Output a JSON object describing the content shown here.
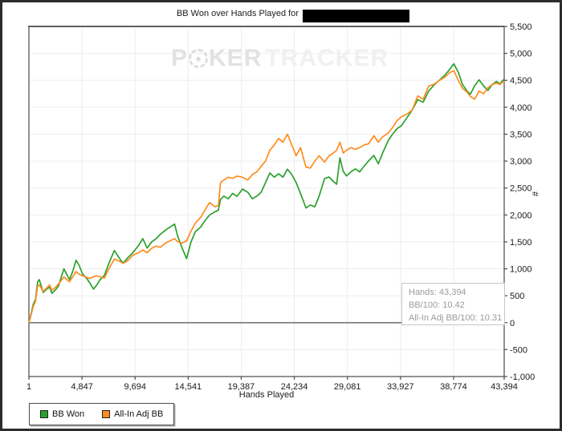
{
  "title": {
    "text": "BB Won over Hands Played for",
    "redacted_subject": ""
  },
  "watermark": {
    "p": "P",
    "ker": "KER",
    "tracker": "TRACKER",
    "spade": "♠"
  },
  "info_box": {
    "lines": [
      "Hands: 43,394",
      "BB/100: 10.42",
      "All-In Adj BB/100: 10.31"
    ]
  },
  "legend": {
    "items": [
      {
        "label": "BB Won",
        "color": "#2ca02c"
      },
      {
        "label": "All-In Adj BB",
        "color": "#ff8c1f"
      }
    ]
  },
  "chart_data": {
    "type": "line",
    "title": "BB Won over Hands Played for",
    "xlabel": "Hands Played",
    "ylabel": "#",
    "xlim": [
      1,
      43394
    ],
    "ylim": [
      -1000,
      5500
    ],
    "grid": true,
    "grid_color": "#ededed",
    "zero_line_color": "#787878",
    "axis_color": "#4a4a4a",
    "legend_position": "bottom-left",
    "x_ticks": {
      "values": [
        1,
        4847,
        9694,
        14541,
        19387,
        24234,
        29081,
        33927,
        38774,
        43394
      ],
      "labels": [
        "1",
        "4,847",
        "9,694",
        "14,541",
        "19,387",
        "24,234",
        "29,081",
        "33,927",
        "38,774",
        "43,394"
      ]
    },
    "y_ticks": {
      "values": [
        5500,
        5000,
        4500,
        4000,
        3500,
        3000,
        2500,
        2000,
        1500,
        1000,
        500,
        0,
        -500,
        -1000
      ],
      "labels": [
        "5,500",
        "5,000",
        "4,500",
        "4,000",
        "3,500",
        "3,000",
        "2,500",
        "2,000",
        "1,500",
        "1,000",
        "500",
        "0",
        "-500",
        "-1,000"
      ]
    },
    "series": [
      {
        "name": "BB Won",
        "color": "#2ca02c",
        "points": [
          [
            1,
            0
          ],
          [
            200,
            160
          ],
          [
            400,
            340
          ],
          [
            600,
            430
          ],
          [
            800,
            760
          ],
          [
            950,
            800
          ],
          [
            1100,
            700
          ],
          [
            1300,
            560
          ],
          [
            1600,
            620
          ],
          [
            1900,
            660
          ],
          [
            2100,
            545
          ],
          [
            2400,
            600
          ],
          [
            2700,
            680
          ],
          [
            2950,
            840
          ],
          [
            3200,
            1000
          ],
          [
            3450,
            900
          ],
          [
            3700,
            800
          ],
          [
            4000,
            950
          ],
          [
            4300,
            1160
          ],
          [
            4600,
            1060
          ],
          [
            4900,
            905
          ],
          [
            5200,
            840
          ],
          [
            5500,
            760
          ],
          [
            5900,
            625
          ],
          [
            6200,
            700
          ],
          [
            6500,
            800
          ],
          [
            6900,
            880
          ],
          [
            7300,
            1100
          ],
          [
            7800,
            1340
          ],
          [
            8200,
            1215
          ],
          [
            8600,
            1100
          ],
          [
            9000,
            1200
          ],
          [
            9500,
            1300
          ],
          [
            10000,
            1430
          ],
          [
            10400,
            1560
          ],
          [
            10800,
            1385
          ],
          [
            11200,
            1500
          ],
          [
            11600,
            1555
          ],
          [
            12000,
            1640
          ],
          [
            12500,
            1720
          ],
          [
            13000,
            1790
          ],
          [
            13300,
            1830
          ],
          [
            13600,
            1600
          ],
          [
            14000,
            1380
          ],
          [
            14400,
            1190
          ],
          [
            14800,
            1500
          ],
          [
            15200,
            1690
          ],
          [
            15700,
            1780
          ],
          [
            16100,
            1900
          ],
          [
            16500,
            2000
          ],
          [
            17000,
            2060
          ],
          [
            17300,
            2090
          ],
          [
            17500,
            2290
          ],
          [
            17800,
            2350
          ],
          [
            18200,
            2300
          ],
          [
            18600,
            2400
          ],
          [
            19000,
            2345
          ],
          [
            19500,
            2480
          ],
          [
            20000,
            2420
          ],
          [
            20400,
            2300
          ],
          [
            20800,
            2350
          ],
          [
            21200,
            2420
          ],
          [
            21600,
            2600
          ],
          [
            22000,
            2780
          ],
          [
            22400,
            2700
          ],
          [
            22800,
            2765
          ],
          [
            23200,
            2700
          ],
          [
            23600,
            2850
          ],
          [
            24000,
            2750
          ],
          [
            24400,
            2600
          ],
          [
            24800,
            2400
          ],
          [
            25300,
            2130
          ],
          [
            25700,
            2185
          ],
          [
            26100,
            2150
          ],
          [
            26500,
            2350
          ],
          [
            27000,
            2675
          ],
          [
            27400,
            2705
          ],
          [
            27800,
            2620
          ],
          [
            28100,
            2570
          ],
          [
            28400,
            3060
          ],
          [
            28700,
            2810
          ],
          [
            29000,
            2725
          ],
          [
            29400,
            2800
          ],
          [
            29800,
            2855
          ],
          [
            30200,
            2800
          ],
          [
            30600,
            2905
          ],
          [
            31000,
            3000
          ],
          [
            31500,
            3105
          ],
          [
            31900,
            2950
          ],
          [
            32300,
            3150
          ],
          [
            32800,
            3380
          ],
          [
            33200,
            3500
          ],
          [
            33600,
            3600
          ],
          [
            34000,
            3655
          ],
          [
            34500,
            3800
          ],
          [
            35000,
            3950
          ],
          [
            35500,
            4140
          ],
          [
            36000,
            4095
          ],
          [
            36500,
            4300
          ],
          [
            37000,
            4415
          ],
          [
            37500,
            4505
          ],
          [
            38000,
            4600
          ],
          [
            38400,
            4700
          ],
          [
            38800,
            4805
          ],
          [
            39200,
            4650
          ],
          [
            39600,
            4420
          ],
          [
            40000,
            4300
          ],
          [
            40300,
            4240
          ],
          [
            40700,
            4400
          ],
          [
            41100,
            4510
          ],
          [
            41500,
            4400
          ],
          [
            41900,
            4310
          ],
          [
            42300,
            4420
          ],
          [
            42700,
            4480
          ],
          [
            43000,
            4430
          ],
          [
            43200,
            4485
          ],
          [
            43394,
            4520
          ]
        ]
      },
      {
        "name": "All-In Adj BB",
        "color": "#ff8c1f",
        "points": [
          [
            1,
            0
          ],
          [
            200,
            140
          ],
          [
            400,
            300
          ],
          [
            600,
            400
          ],
          [
            800,
            680
          ],
          [
            950,
            700
          ],
          [
            1100,
            650
          ],
          [
            1300,
            580
          ],
          [
            1600,
            640
          ],
          [
            1900,
            700
          ],
          [
            2100,
            600
          ],
          [
            2400,
            650
          ],
          [
            2700,
            720
          ],
          [
            2950,
            780
          ],
          [
            3200,
            850
          ],
          [
            3450,
            800
          ],
          [
            3700,
            760
          ],
          [
            4000,
            850
          ],
          [
            4300,
            950
          ],
          [
            4600,
            900
          ],
          [
            4900,
            870
          ],
          [
            5200,
            850
          ],
          [
            5500,
            820
          ],
          [
            5900,
            850
          ],
          [
            6200,
            870
          ],
          [
            6500,
            850
          ],
          [
            6900,
            830
          ],
          [
            7300,
            1000
          ],
          [
            7800,
            1180
          ],
          [
            8200,
            1150
          ],
          [
            8600,
            1100
          ],
          [
            9000,
            1150
          ],
          [
            9500,
            1250
          ],
          [
            10000,
            1300
          ],
          [
            10400,
            1350
          ],
          [
            10800,
            1300
          ],
          [
            11200,
            1380
          ],
          [
            11600,
            1420
          ],
          [
            12000,
            1400
          ],
          [
            12500,
            1480
          ],
          [
            13000,
            1530
          ],
          [
            13300,
            1560
          ],
          [
            13600,
            1500
          ],
          [
            14000,
            1480
          ],
          [
            14400,
            1520
          ],
          [
            14800,
            1700
          ],
          [
            15200,
            1850
          ],
          [
            15700,
            1960
          ],
          [
            16100,
            2100
          ],
          [
            16500,
            2230
          ],
          [
            17000,
            2150
          ],
          [
            17300,
            2180
          ],
          [
            17500,
            2600
          ],
          [
            17800,
            2650
          ],
          [
            18200,
            2700
          ],
          [
            18600,
            2680
          ],
          [
            19000,
            2720
          ],
          [
            19500,
            2700
          ],
          [
            20000,
            2650
          ],
          [
            20400,
            2750
          ],
          [
            20800,
            2800
          ],
          [
            21200,
            2900
          ],
          [
            21600,
            3000
          ],
          [
            22000,
            3200
          ],
          [
            22400,
            3300
          ],
          [
            22800,
            3420
          ],
          [
            23200,
            3350
          ],
          [
            23600,
            3500
          ],
          [
            24000,
            3300
          ],
          [
            24400,
            3100
          ],
          [
            24800,
            3250
          ],
          [
            25300,
            2890
          ],
          [
            25700,
            2870
          ],
          [
            26100,
            3000
          ],
          [
            26500,
            3100
          ],
          [
            27000,
            2980
          ],
          [
            27400,
            3100
          ],
          [
            27800,
            3150
          ],
          [
            28100,
            3200
          ],
          [
            28400,
            3350
          ],
          [
            28700,
            3150
          ],
          [
            29000,
            3200
          ],
          [
            29400,
            3250
          ],
          [
            29800,
            3220
          ],
          [
            30200,
            3250
          ],
          [
            30600,
            3300
          ],
          [
            31000,
            3320
          ],
          [
            31500,
            3470
          ],
          [
            31900,
            3350
          ],
          [
            32300,
            3450
          ],
          [
            32800,
            3520
          ],
          [
            33200,
            3620
          ],
          [
            33600,
            3750
          ],
          [
            34000,
            3820
          ],
          [
            34500,
            3870
          ],
          [
            35000,
            3950
          ],
          [
            35500,
            4210
          ],
          [
            36000,
            4150
          ],
          [
            36500,
            4390
          ],
          [
            37000,
            4430
          ],
          [
            37500,
            4500
          ],
          [
            38000,
            4560
          ],
          [
            38400,
            4640
          ],
          [
            38800,
            4680
          ],
          [
            39200,
            4500
          ],
          [
            39600,
            4350
          ],
          [
            40000,
            4280
          ],
          [
            40300,
            4200
          ],
          [
            40700,
            4150
          ],
          [
            41100,
            4300
          ],
          [
            41500,
            4250
          ],
          [
            41900,
            4360
          ],
          [
            42300,
            4420
          ],
          [
            42700,
            4450
          ],
          [
            43000,
            4420
          ],
          [
            43200,
            4460
          ],
          [
            43394,
            4474
          ]
        ]
      }
    ]
  }
}
